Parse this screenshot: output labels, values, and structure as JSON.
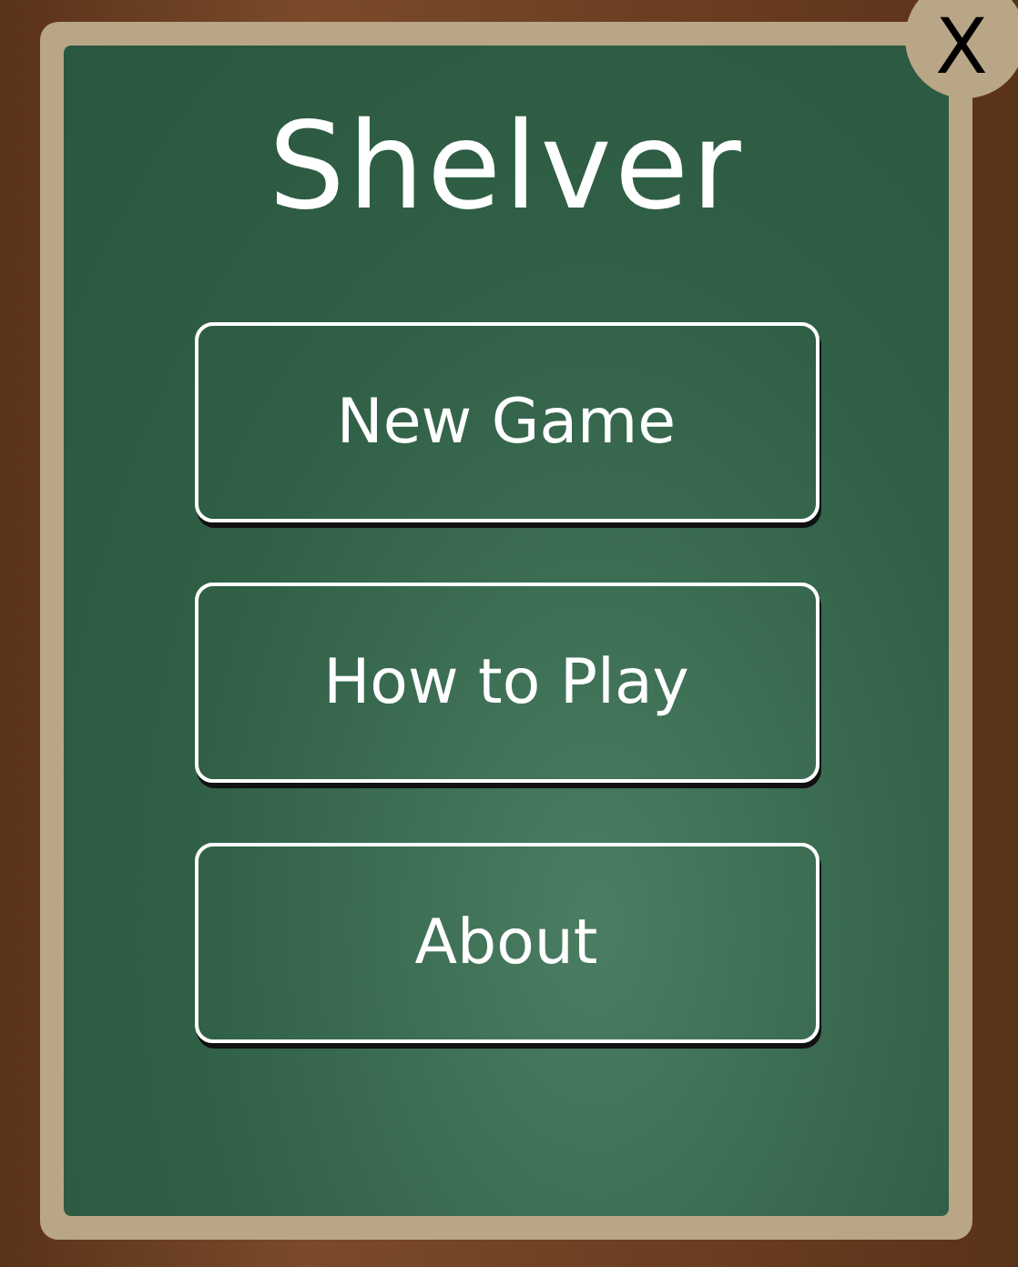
{
  "title": "Shelver",
  "close": "X",
  "buttons": [
    {
      "label": "New Game"
    },
    {
      "label": "How to Play"
    },
    {
      "label": "About"
    }
  ]
}
